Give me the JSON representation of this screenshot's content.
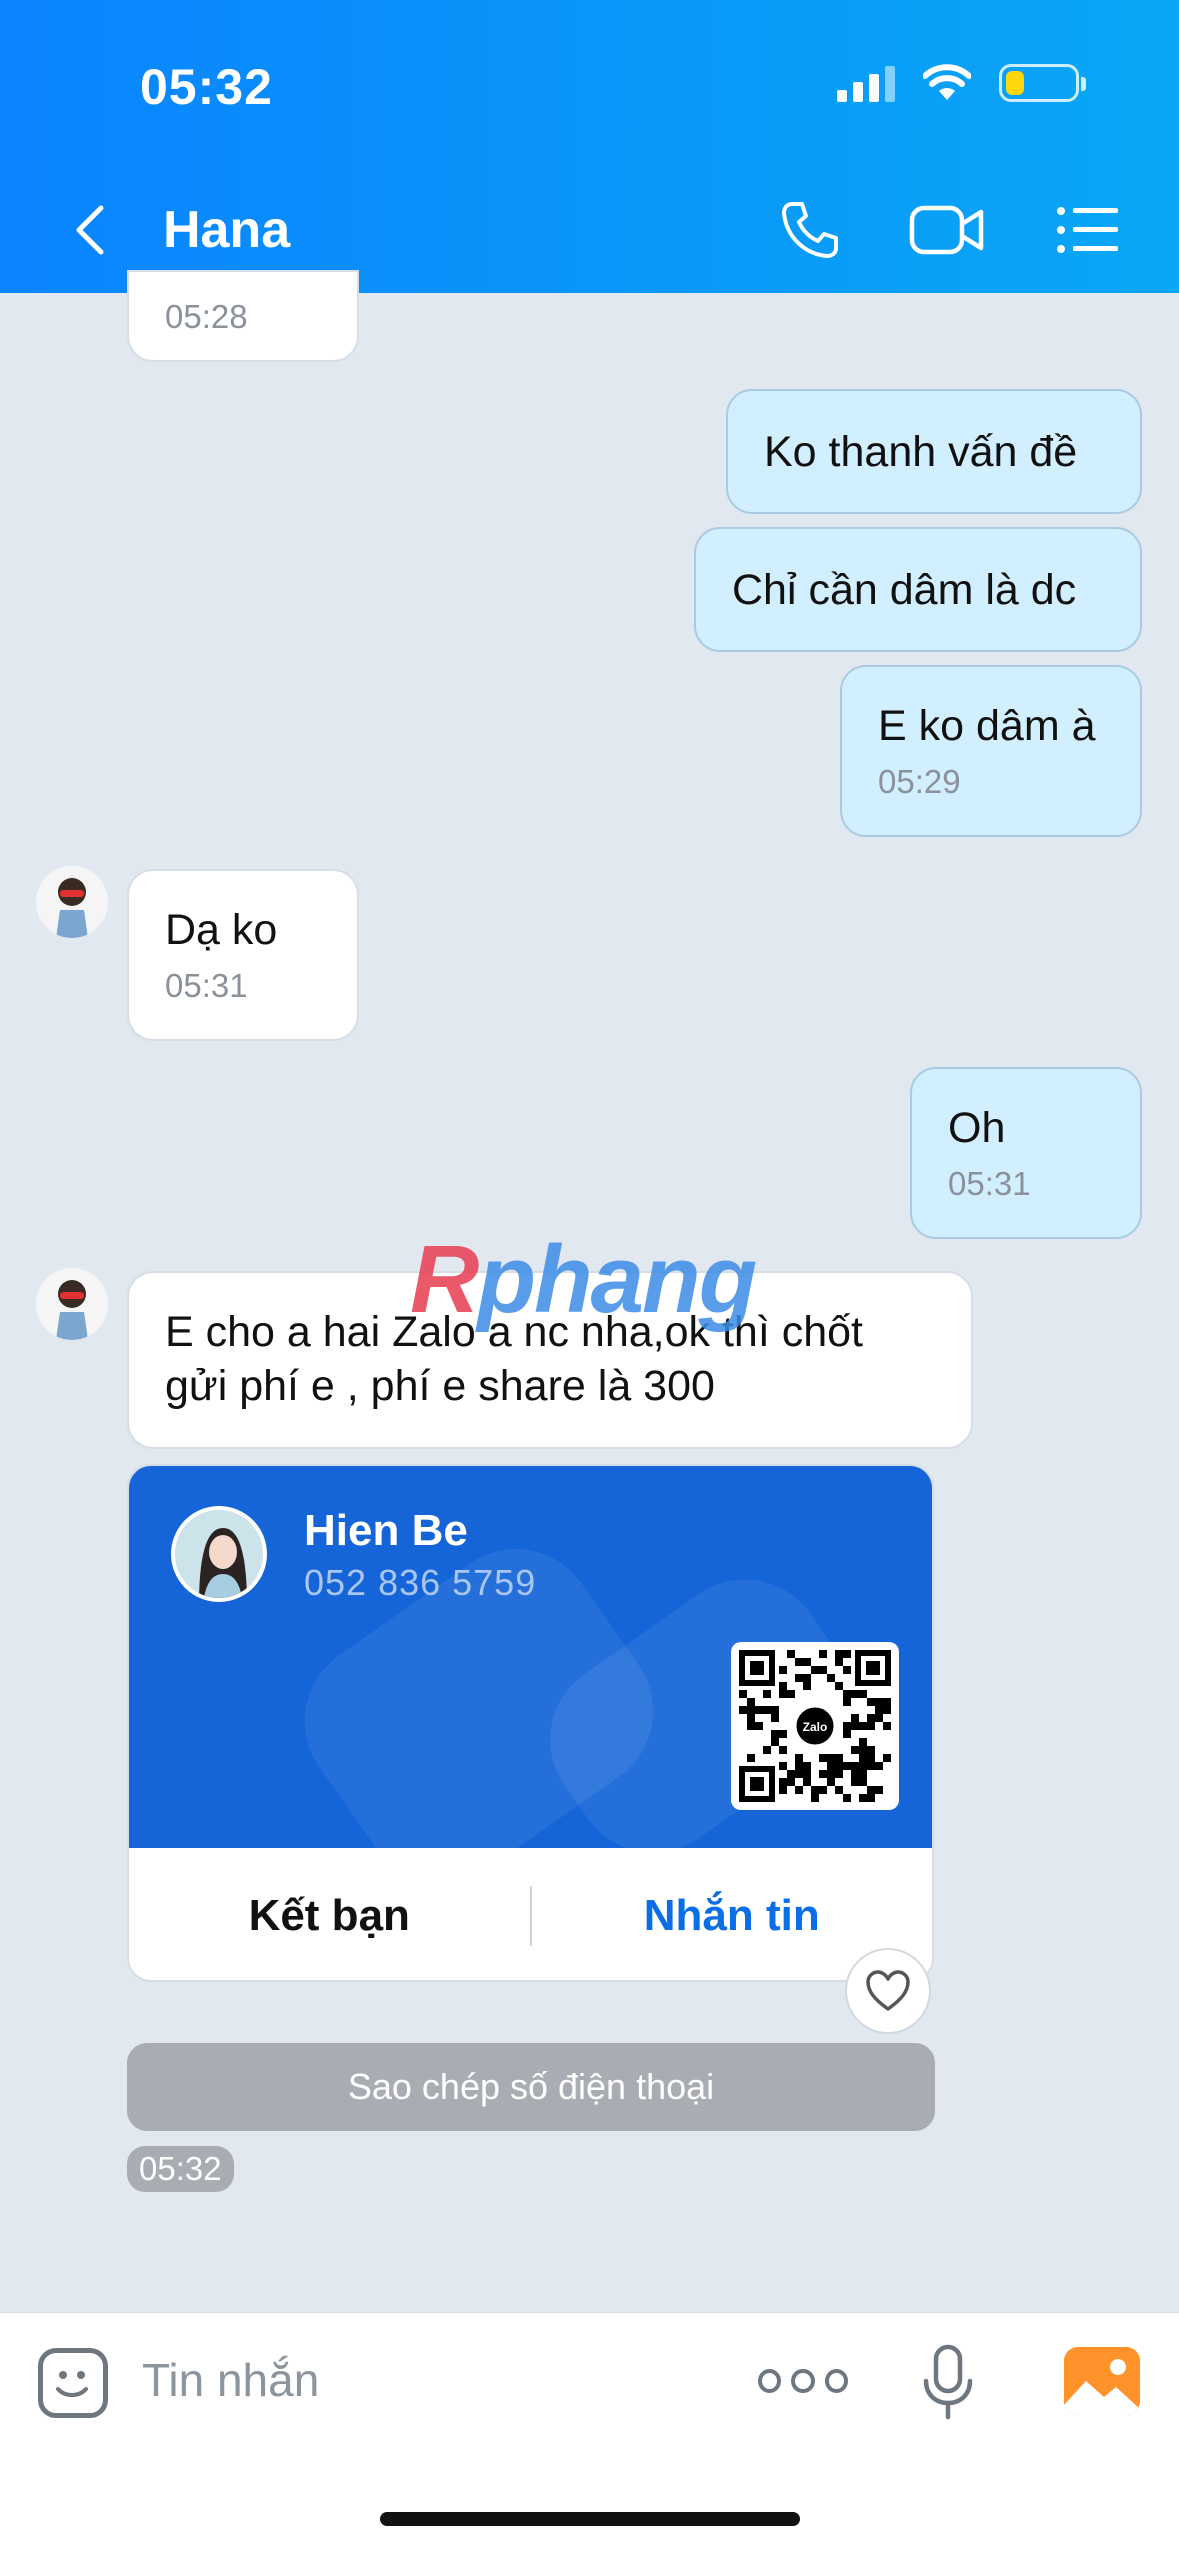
{
  "status_bar": {
    "time": "05:32"
  },
  "header": {
    "title": "Hana"
  },
  "messages": [
    {
      "time": "05:28"
    },
    {
      "text": "Ko thanh vấn đề"
    },
    {
      "text": "Chỉ cần dâm là dc"
    },
    {
      "text": "E ko dâm à",
      "time": "05:29"
    },
    {
      "text": "Dạ ko",
      "time": "05:31"
    },
    {
      "text": "Oh",
      "time": "05:31"
    },
    {
      "text_line1": "E cho a hai Zalo a nc nha,ok thì chốt",
      "text_line2": "gửi phí e , phí e share là 300"
    }
  ],
  "contact_card": {
    "name": "Hien Be",
    "phone": "052 836 5759",
    "qr_logo": "Zalo",
    "add_friend_label": "Kết bạn",
    "message_label": "Nhắn tin",
    "copy_phone_label": "Sao chép số điện thoại",
    "time": "05:32"
  },
  "watermark": {
    "part1": "R",
    "part2": "phang"
  },
  "input": {
    "placeholder": "Tin nhắn"
  },
  "colors": {
    "header": "#0a84ff",
    "out_bubble": "#d2efff",
    "card": "#1565d8",
    "message_link": "#0a6ee8"
  }
}
